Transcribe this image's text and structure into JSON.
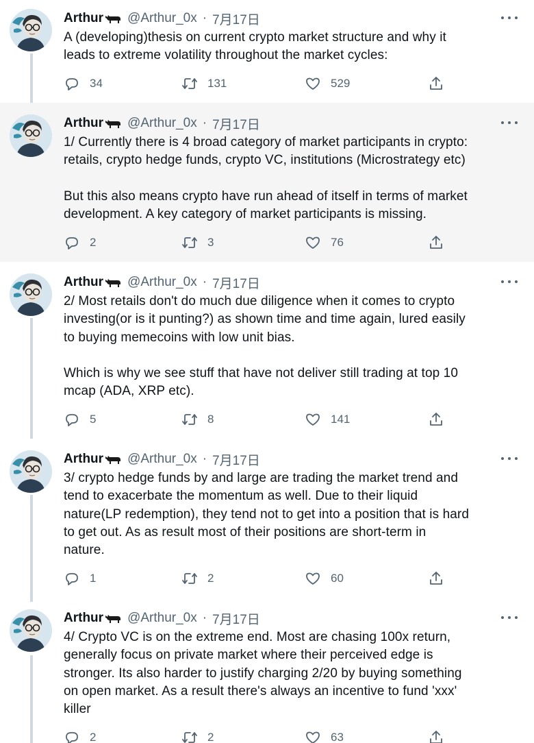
{
  "author": {
    "name": "Arthur",
    "handle": "@Arthur_0x",
    "separator": "·",
    "date": "7月17日"
  },
  "icons": {
    "more": "more-horizontal-icon",
    "reply": "reply-icon",
    "retweet": "retweet-icon",
    "like": "heart-icon",
    "share": "share-icon",
    "badge": "bull-icon"
  },
  "colors": {
    "text": "#0f1419",
    "secondary": "#536471",
    "highlight_bg": "#f5f5f5",
    "thread_line": "#cfd9de"
  },
  "tweets": [
    {
      "lines": [
        "A (developing)thesis on current crypto market structure and why it",
        "leads to extreme volatility throughout the market cycles:"
      ],
      "replies": "34",
      "retweets": "131",
      "likes": "529"
    },
    {
      "lines": [
        "1/ Currently there is 4 broad category of market participants in crypto:",
        "retails, crypto hedge funds, crypto VC, institutions (Microstrategy etc)",
        "",
        "But this also means crypto have run ahead of itself in terms of market",
        "development. A key category of market participants is missing."
      ],
      "replies": "2",
      "retweets": "3",
      "likes": "76"
    },
    {
      "lines": [
        "2/ Most retails don't do much due diligence when it comes to crypto",
        "investing(or is it punting?) as shown time and time again, lured easily",
        "to buying memecoins with low unit bias.",
        "",
        "Which is why we see stuff that have not deliver still trading at top 10",
        "mcap (ADA, XRP etc)."
      ],
      "replies": "5",
      "retweets": "8",
      "likes": "141"
    },
    {
      "lines": [
        "3/ crypto hedge funds by and large are trading the market trend and",
        "tend to exacerbate the momentum as well. Due to their liquid",
        "nature(LP redemption), they tend not to get into a position that is hard",
        "to get out. As as result most of their positions are short-term in",
        "nature."
      ],
      "replies": "1",
      "retweets": "2",
      "likes": "60"
    },
    {
      "lines": [
        "4/ Crypto VC is on the extreme end. Most are chasing 100x return,",
        "generally focus on private market where their perceived edge is",
        "stronger. Its also harder to justify charging 2/20 by buying something",
        "on open market. As a result there's always an incentive to fund 'xxx'",
        "killer"
      ],
      "replies": "2",
      "retweets": "2",
      "likes": "63"
    }
  ]
}
